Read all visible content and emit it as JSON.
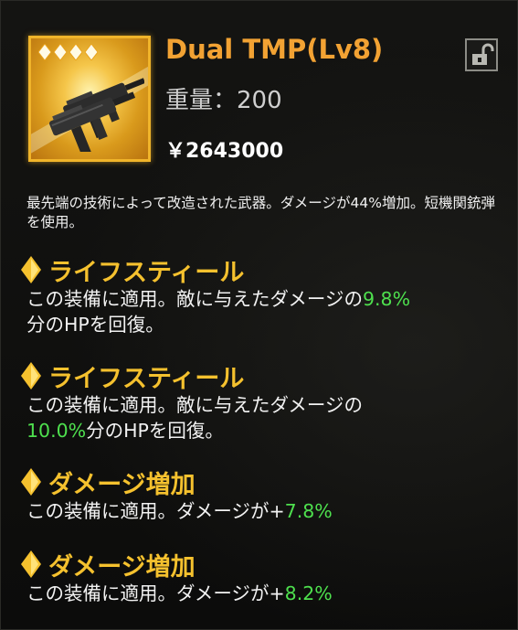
{
  "item": {
    "name": "Dual TMP(Lv8)",
    "weight": "重量：200",
    "price": "￥2643000",
    "rarity_stars": 4,
    "icon": "submachine-gun-icon",
    "lock_icon": "padlock-open-icon",
    "description": "最先端の技術によって改造された武器。ダメージが44%増加。短機関銃弾を使用。"
  },
  "effects": [
    {
      "title": "ライフスティール",
      "text_before": "この装備に適用。敵に与えたダメージの",
      "value": "9.8%",
      "text_after": "分のHPを回復。"
    },
    {
      "title": "ライフスティール",
      "text_before": "この装備に適用。敵に与えたダメージの",
      "value": "10.0%",
      "text_after": "分のHPを回復。"
    },
    {
      "title": "ダメージ増加",
      "text_before": "この装備に適用。ダメージが+",
      "value": "7.8%",
      "text_after": ""
    },
    {
      "title": "ダメージ増加",
      "text_before": "この装備に適用。ダメージが+",
      "value": "8.2%",
      "text_after": ""
    }
  ],
  "colors": {
    "title": "#f2a233",
    "effect_title": "#f5c12e",
    "value_green": "#4ee04e",
    "rarity_gold": "#f0b42a"
  }
}
